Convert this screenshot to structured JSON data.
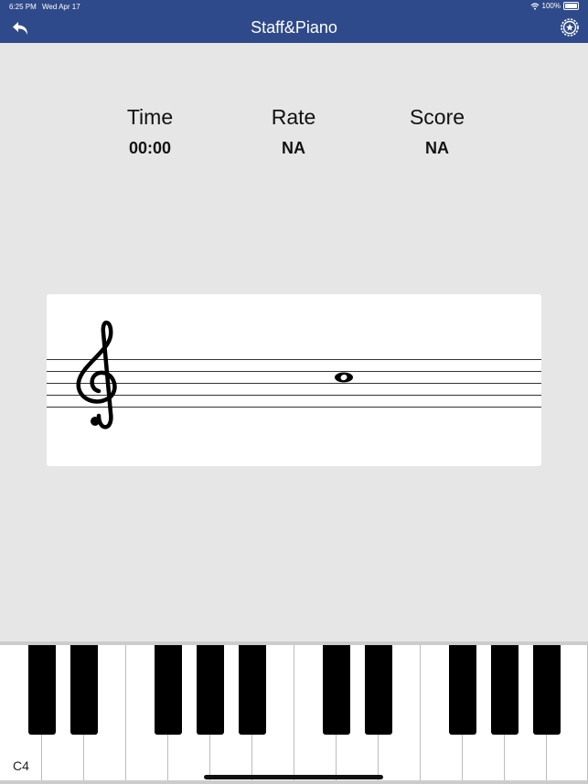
{
  "status_bar": {
    "time": "6:25 PM",
    "date": "Wed Apr 17",
    "battery": "100%"
  },
  "nav": {
    "title": "Staff&Piano",
    "back_icon": "back-arrow-icon",
    "settings_icon": "gear-icon"
  },
  "stats": [
    {
      "label": "Time",
      "value": "00:00"
    },
    {
      "label": "Rate",
      "value": "NA"
    },
    {
      "label": "Score",
      "value": "NA"
    }
  ],
  "staff": {
    "clef": "treble",
    "note": "whole"
  },
  "piano": {
    "first_key_label": "C4"
  }
}
